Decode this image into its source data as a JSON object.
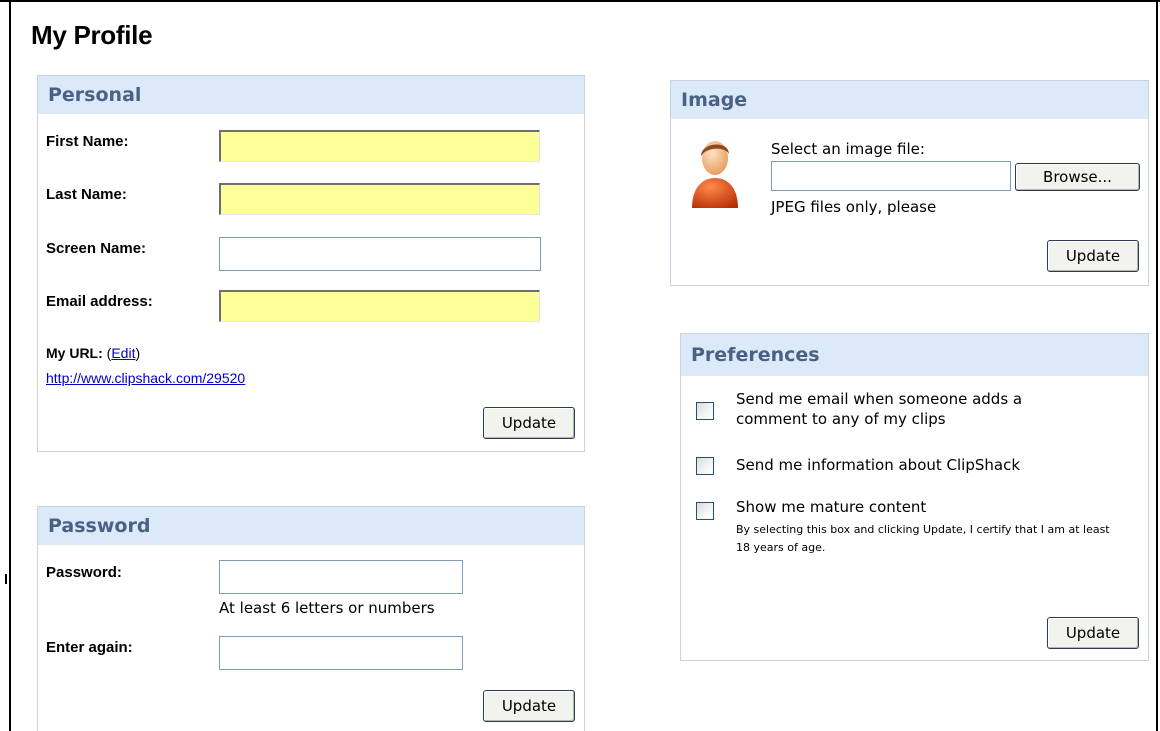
{
  "page": {
    "title": "My Profile"
  },
  "personal": {
    "header": "Personal",
    "first_name_label": "First Name:",
    "first_name_value": "",
    "last_name_label": "Last Name:",
    "last_name_value": "",
    "screen_name_label": "Screen Name:",
    "screen_name_value": "",
    "email_label": "Email address:",
    "email_value": "",
    "url_label": "My URL:",
    "url_paren_open": "(",
    "url_edit_link": "Edit",
    "url_paren_close": ")",
    "url_value": "http://www.clipshack.com/29520",
    "update_button": "Update"
  },
  "password": {
    "header": "Password",
    "password_label": "Password:",
    "password_hint": "At least 6 letters or numbers",
    "enter_again_label": "Enter again:",
    "update_button": "Update"
  },
  "image": {
    "header": "Image",
    "select_label": "Select an image file:",
    "file_value": "",
    "browse_button": "Browse...",
    "hint": "JPEG files only, please",
    "update_button": "Update"
  },
  "preferences": {
    "header": "Preferences",
    "items": [
      {
        "label": "Send me email when someone adds a comment to any of my clips",
        "checked": false
      },
      {
        "label": "Send me information about ClipShack",
        "checked": false
      },
      {
        "label": "Show me mature content",
        "checked": false
      }
    ],
    "mature_note": "By selecting this box and clicking Update, I certify that I am at least 18 years of age.",
    "update_button": "Update"
  },
  "colors": {
    "panel_header_bg": "#dce9f9",
    "panel_header_text": "#4a6186",
    "required_field_bg": "#ffff99",
    "link": "#0000cc"
  },
  "icons": {
    "avatar": "user-avatar-icon"
  }
}
